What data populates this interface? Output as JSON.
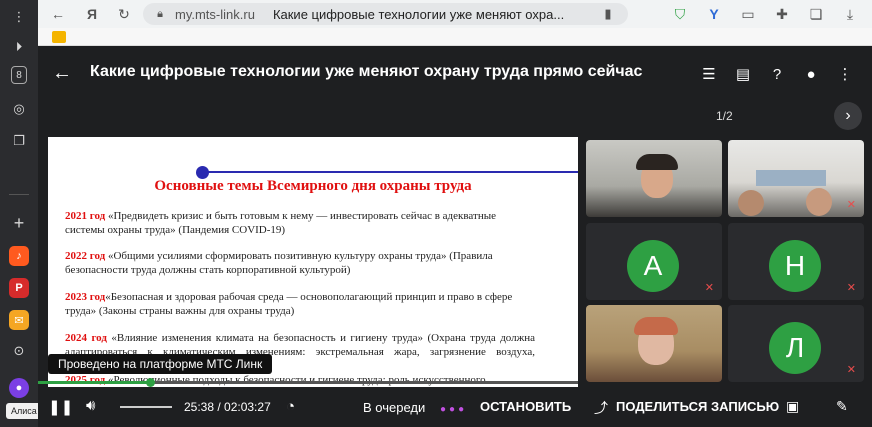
{
  "browser": {
    "domain": "my.mts-link.ru",
    "tab_title": "Какие цифровые технологии уже меняют охра..."
  },
  "sidebar": {
    "alice_label": "Алиса",
    "tab_count": "8"
  },
  "webinar": {
    "title": "Какие цифровые технологии уже меняют охрану труда прямо сейчас",
    "page_indicator": "1/2"
  },
  "slide": {
    "heading": "Основные темы Всемирного дня охраны труда",
    "items": [
      {
        "year": "2021 год",
        "text": " «Предвидеть кризис и быть готовым к нему — инвестировать сейчас в адекватные системы охраны труда» (Пандемия COVID-19)"
      },
      {
        "year": "2022 год",
        "text": " «Общими усилиями сформировать позитивную культуру охраны труда» (Правила безопасности труда должны стать корпоративной культурой)"
      },
      {
        "year": "2023 год",
        "text": "«Безопасная и здоровая рабочая среда — основополагающий принцип и право в сфере труда» (Законы страны важны для охраны труда)"
      },
      {
        "year": "2024 год",
        "text": " «Влияние изменения климата на безопасность и гигиену труда» (Охрана труда должна адаптироваться к климатическим изменениям: экстремальная жара, загрязнение воздуха, похолодание)"
      },
      {
        "year": "2025 год",
        "text": " «Революционные подходы к безопасности и гигиене труда: роль искусственного интеллекта (ИИ) и цифровизации на рабочих местах»"
      }
    ]
  },
  "participants": [
    {
      "type": "video"
    },
    {
      "type": "video"
    },
    {
      "type": "avatar",
      "initial": "А"
    },
    {
      "type": "avatar",
      "initial": "Н"
    },
    {
      "type": "video"
    },
    {
      "type": "avatar",
      "initial": "Л"
    }
  ],
  "player": {
    "tooltip": "Проведено на платформе МТС Линк",
    "time": "25:38 / 02:03:27",
    "progress": 0.207,
    "queue_label": "В очереди",
    "stop_label": "ОСТАНОВИТЬ",
    "share_label": "ПОДЕЛИТЬСЯ ЗАПИСЬЮ"
  },
  "colors": {
    "accent_green": "#2ea043",
    "slide_red": "#e01010",
    "slide_blue": "#2a2ab0"
  }
}
